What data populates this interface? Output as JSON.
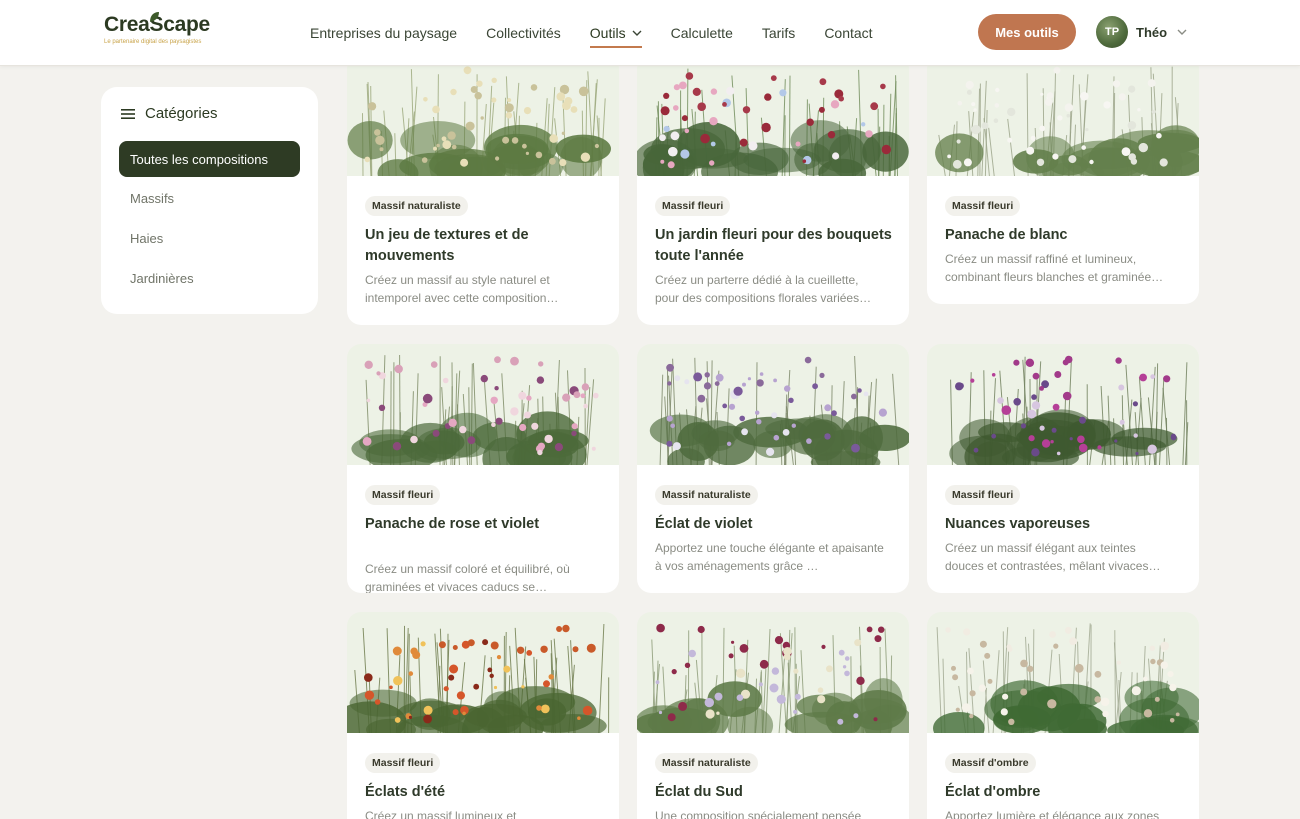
{
  "header": {
    "logo": {
      "name": "CreaScape",
      "tagline": "Le partenaire digital des paysagistes"
    },
    "nav": [
      {
        "label": "Entreprises du paysage"
      },
      {
        "label": "Collectivités"
      },
      {
        "label": "Outils",
        "active": true,
        "has_dropdown": true
      },
      {
        "label": "Calculette"
      },
      {
        "label": "Tarifs"
      },
      {
        "label": "Contact"
      }
    ],
    "cta_label": "Mes outils",
    "user": {
      "initials": "TP",
      "name": "Théo"
    }
  },
  "sidebar": {
    "title": "Catégories",
    "items": [
      {
        "label": "Toutes les compositions",
        "active": true
      },
      {
        "label": "Massifs"
      },
      {
        "label": "Haies"
      },
      {
        "label": "Jardinières"
      }
    ]
  },
  "cards": [
    {
      "badge": "Massif naturaliste",
      "title": "Un jeu de textures et de mouvements",
      "desc": "Créez un massif au style naturel et intemporel avec cette composition…",
      "palette": "grass"
    },
    {
      "badge": "Massif fleuri",
      "title": "Un jardin fleuri pour des bouquets toute l'année",
      "desc": "Créez un parterre dédié à la cueillette, pour des compositions florales variées…",
      "palette": "bouquet"
    },
    {
      "badge": "Massif fleuri",
      "title": "Panache de blanc",
      "desc": "Créez un massif raffiné et lumineux, combinant fleurs blanches et graminée…",
      "palette": "white"
    },
    {
      "badge": "Massif fleuri",
      "title": "Panache de rose et violet",
      "desc": "Créez un massif coloré et équilibré, où graminées et vivaces caducs se…",
      "palette": "pink"
    },
    {
      "badge": "Massif naturaliste",
      "title": "Éclat de violet",
      "desc": "Apportez une touche élégante et apaisante à vos aménagements grâce …",
      "palette": "violet"
    },
    {
      "badge": "Massif fleuri",
      "title": "Nuances vaporeuses",
      "desc": "Créez un massif élégant aux teintes douces et contrastées, mêlant vivaces…",
      "palette": "magenta"
    },
    {
      "badge": "Massif fleuri",
      "title": "Éclats d'été",
      "desc": "Créez un massif lumineux et",
      "palette": "summer"
    },
    {
      "badge": "Massif naturaliste",
      "title": "Éclat du Sud",
      "desc": "Une composition spécialement pensée",
      "palette": "south"
    },
    {
      "badge": "Massif d'ombre",
      "title": "Éclat d'ombre",
      "desc": "Apportez lumière et élégance aux zones",
      "palette": "shade"
    }
  ],
  "colors": {
    "accent": "#c07650",
    "dark_green": "#2e3b24",
    "background": "#f3f2ee"
  }
}
